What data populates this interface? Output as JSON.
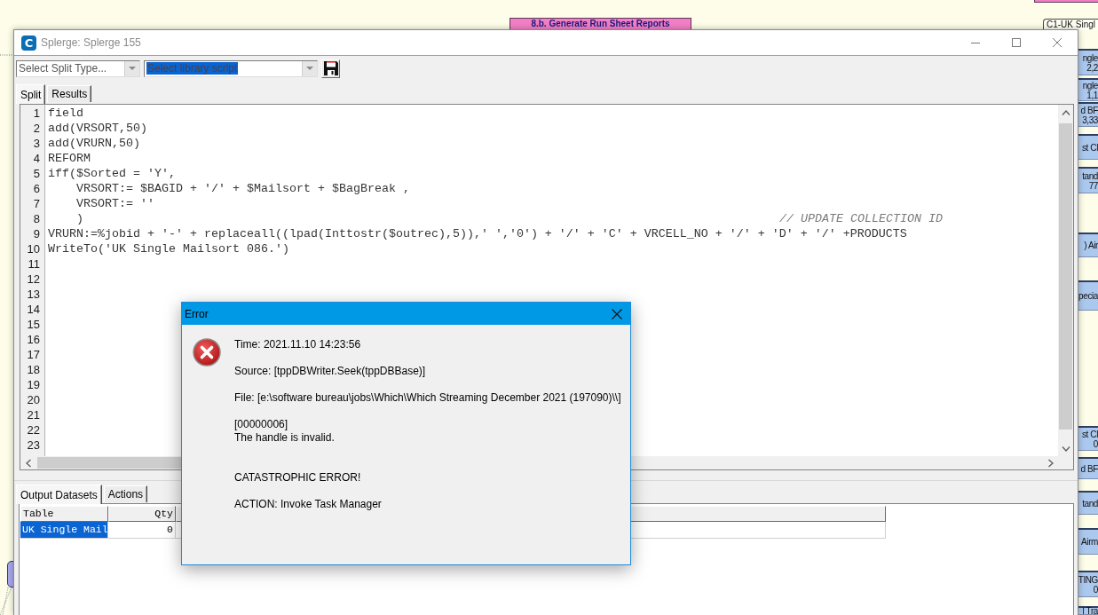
{
  "canvas": {
    "header_node": "8.b. Generate Run Sheet Reports",
    "side_nodes": [
      {
        "kind": "outline",
        "lines": [
          "C1-UK Singl"
        ]
      },
      {
        "kind": "filled",
        "lines": [
          "ngle",
          "2,2"
        ]
      },
      {
        "kind": "filled",
        "lines": [
          "ngle",
          "1,1"
        ]
      },
      {
        "kind": "filled",
        "lines": [
          "d BF",
          "3,33"
        ]
      },
      {
        "kind": "filled",
        "lines": [
          "st Cl"
        ]
      },
      {
        "kind": "filled",
        "lines": [
          "tand",
          "77"
        ]
      },
      {
        "kind": "filled",
        "lines": [
          ") Air"
        ]
      },
      {
        "kind": "filled",
        "lines": [
          "pecia"
        ]
      },
      {
        "kind": "filled",
        "lines": [
          "st Cl",
          "0"
        ]
      },
      {
        "kind": "filled",
        "lines": [
          "d BF"
        ]
      },
      {
        "kind": "filled",
        "lines": [
          "tand"
        ]
      },
      {
        "kind": "filled",
        "lines": [
          "Airm"
        ]
      },
      {
        "kind": "filled",
        "lines": [
          "TING",
          "0"
        ]
      },
      {
        "kind": "filled",
        "lines": [
          "l Tra"
        ]
      }
    ]
  },
  "window": {
    "logo_text": "C",
    "title": "Splerge: Splerge 155"
  },
  "toolbar": {
    "split_type": {
      "placeholder": "Select Split Type..."
    },
    "library_script": {
      "placeholder": "Select library script",
      "highlighted": true
    }
  },
  "tabs": [
    {
      "label": "Split",
      "selected": true
    },
    {
      "label": "Results",
      "selected": false
    }
  ],
  "editor": {
    "lines": [
      {
        "number": "1",
        "code": "field"
      },
      {
        "number": "2",
        "code": "add(VRSORT,50)"
      },
      {
        "number": "3",
        "code": "add(VRURN,50)"
      },
      {
        "number": "4",
        "code": "REFORM"
      },
      {
        "number": "5",
        "code": "iff($Sorted = 'Y',"
      },
      {
        "number": "6",
        "code": "    VRSORT:= $BAGID + '/' + $Mailsort + $BagBreak ,"
      },
      {
        "number": "7",
        "code": "    VRSORT:= ''"
      },
      {
        "number": "8",
        "code": "    )",
        "comment": "// UPDATE COLLECTION ID"
      },
      {
        "number": "9",
        "code": "VRURN:=%jobid + '-' + replaceall((lpad(Inttostr($outrec),5)),' ','0') + '/' + 'C' + VRCELL_NO + '/' + 'D' + '/' +PRODUCTS"
      },
      {
        "number": "10",
        "code": "WriteTo('UK Single Mailsort 086.')"
      },
      {
        "number": "11"
      },
      {
        "number": "12"
      },
      {
        "number": "13"
      },
      {
        "number": "14"
      },
      {
        "number": "15"
      },
      {
        "number": "16"
      },
      {
        "number": "17"
      },
      {
        "number": "18"
      },
      {
        "number": "19"
      },
      {
        "number": "20"
      },
      {
        "number": "21"
      },
      {
        "number": "22"
      },
      {
        "number": "23"
      }
    ]
  },
  "bottom_tabs": [
    {
      "label": "Output Datasets",
      "selected": true
    },
    {
      "label": "Actions",
      "selected": false
    }
  ],
  "output_table": {
    "columns": [
      "Table",
      "Qty"
    ],
    "rows": [
      {
        "cells": [
          "UK Single Mail",
          "0"
        ],
        "selected": true
      }
    ]
  },
  "error_dialog": {
    "title": "Error",
    "message": "Time: 2021.11.10 14:23:56\n\nSource: [tppDBWriter.Seek(tppDBBase)]\n\nFile: [e:\\software bureau\\jobs\\Which\\Which Streaming December 2021 (197090)\\\\]\n\n[00000006]\nThe handle is invalid.\n\n\nCATASTROPHIC ERROR!\n\nACTION: Invoke Task Manager"
  }
}
